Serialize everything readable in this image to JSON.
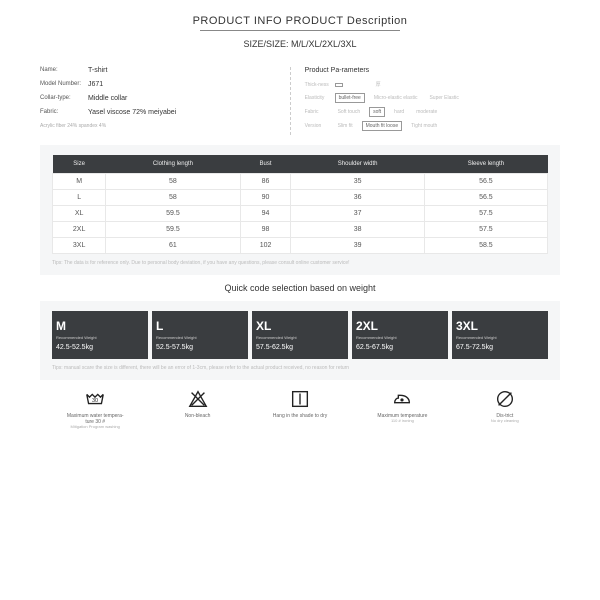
{
  "header": {
    "title": "PRODUCT INFO PRODUCT Description",
    "size_line": "SIZE/SIZE: M/L/XL/2XL/3XL"
  },
  "info": {
    "name_label": "Name:",
    "name": "T-shirt",
    "model_label": "Model Number:",
    "model": "J671",
    "collar_label": "Collar-type:",
    "collar": "Middle collar",
    "fabric_label": "Fabric:",
    "fabric": "Yasel viscose 72% meiyabei",
    "note": "Acrylic fiber 24% spandex 4%"
  },
  "params": {
    "title": "Product Pa-rameters",
    "rows": [
      {
        "label": "Thick-ness",
        "opts": [
          "",
          "",
          ""
        ],
        "active": 0,
        "extra": "厚"
      },
      {
        "label": "Elasticity",
        "opts": [
          "bullet-free",
          "Micro-elastic elastic",
          "Super Elastic"
        ],
        "active": 0
      },
      {
        "label": "Fabric",
        "opts": [
          "Soft touch",
          "soft",
          "hard",
          "moderate"
        ],
        "active": 1
      },
      {
        "label": "Version",
        "opts": [
          "Slim fit",
          "Mouth fit loose",
          "Tight mouth"
        ],
        "active": 1
      }
    ]
  },
  "size_table": {
    "headers": [
      "Size",
      "Clothing length",
      "Bust",
      "Shoulder width",
      "Sleeve length"
    ],
    "rows": [
      [
        "M",
        "58",
        "86",
        "35",
        "56.5"
      ],
      [
        "L",
        "58",
        "90",
        "36",
        "56.5"
      ],
      [
        "XL",
        "59.5",
        "94",
        "37",
        "57.5"
      ],
      [
        "2XL",
        "59.5",
        "98",
        "38",
        "57.5"
      ],
      [
        "3XL",
        "61",
        "102",
        "39",
        "58.5"
      ]
    ],
    "tips": "Tips: The data is for reference only. Due to personal body deviation, if you have any questions, please consult online customer service!"
  },
  "weight": {
    "title": "Quick code selection based on weight",
    "cards": [
      {
        "size": "M",
        "label": "Recommended Weight",
        "range": "42.5-52.5kg"
      },
      {
        "size": "L",
        "label": "Recommended Weight",
        "range": "52.5-57.5kg"
      },
      {
        "size": "XL",
        "label": "Recommended Weight",
        "range": "57.5-62.5kg"
      },
      {
        "size": "2XL",
        "label": "Recommended Weight",
        "range": "62.5-67.5kg"
      },
      {
        "size": "3XL",
        "label": "Recommended Weight",
        "range": "67.5-72.5kg"
      }
    ],
    "tips": "Tips: manual scare the size is different, there will be an error of 1-3cm, please refer to the actual product received, no reason for return"
  },
  "care": [
    {
      "icon": "wash-icon",
      "line1": "Maximum water tempera-ture 30 #",
      "line2": "Mitigation Program washing"
    },
    {
      "icon": "bleach-icon",
      "line1": "Non-bleach",
      "line2": ""
    },
    {
      "icon": "dry-icon",
      "line1": "Hang in the shade to dry",
      "line2": ""
    },
    {
      "icon": "iron-icon",
      "line1": "Maximum temperature",
      "line2": "110 # ironing"
    },
    {
      "icon": "dryclean-icon",
      "line1": "Dis-trict",
      "line2": "No dry cleaning"
    }
  ]
}
